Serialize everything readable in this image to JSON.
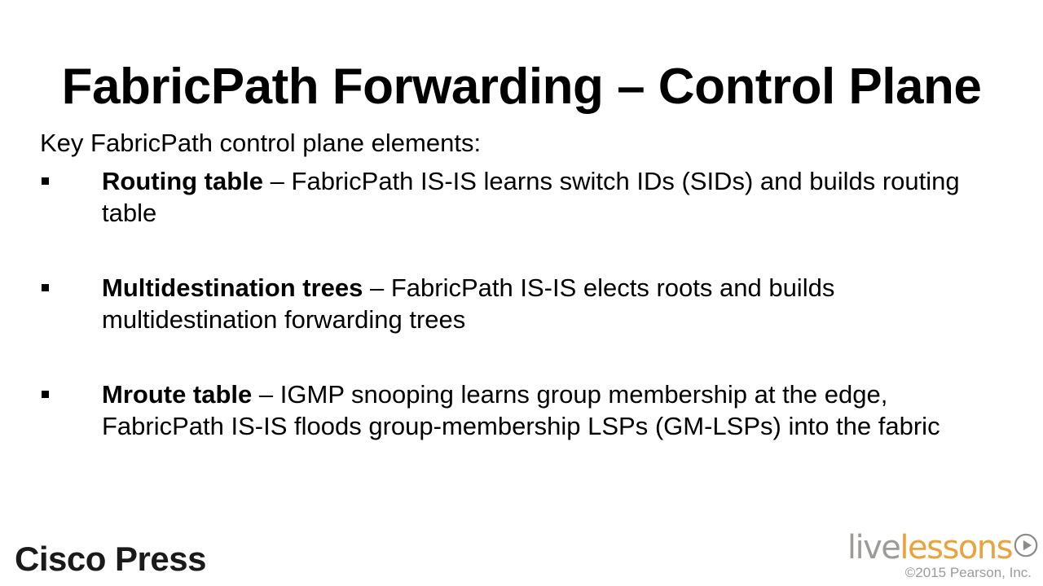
{
  "slide": {
    "title": "FabricPath Forwarding – Control Plane",
    "intro": "Key FabricPath control plane elements:",
    "bullets": [
      {
        "marker": "square-bullet",
        "term": "Routing table",
        "dash": " – ",
        "text": "FabricPath IS-IS learns switch IDs (SIDs) and builds routing table"
      },
      {
        "marker": "square-bullet",
        "term": "Multidestination trees",
        "dash": " – ",
        "text": "FabricPath IS-IS elects roots and builds multidestination forwarding trees"
      },
      {
        "marker": "square-bullet",
        "term": "Mroute table",
        "dash": " – ",
        "text": "IGMP snooping learns group membership at the edge, FabricPath IS-IS floods group-membership LSPs (GM-LSPs) into the fabric"
      }
    ]
  },
  "footer": {
    "publisher": "Cisco Press",
    "logo": {
      "part1": "live",
      "part2": "lessons",
      "play_icon": "play-circle-icon",
      "part1_color": "#9d9b98",
      "part2_color": "#e8a33c"
    },
    "copyright": "©2015 Pearson, Inc."
  }
}
